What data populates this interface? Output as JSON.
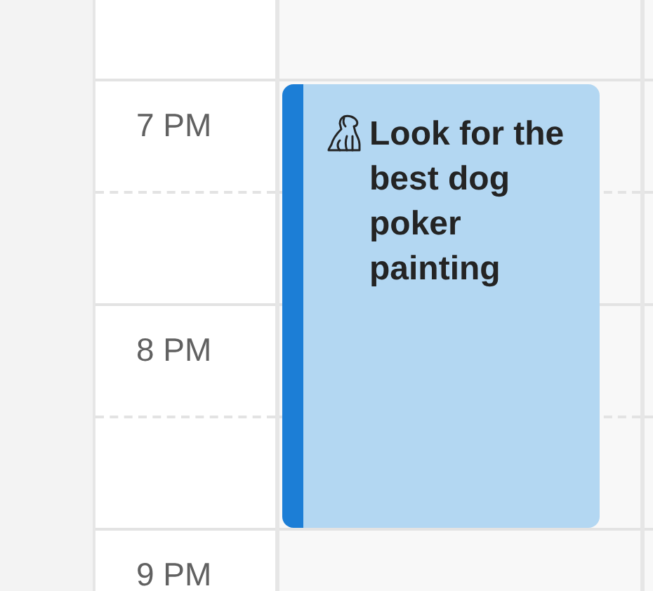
{
  "hours": [
    {
      "label": "7 PM"
    },
    {
      "label": "8 PM"
    },
    {
      "label": "9 PM"
    }
  ],
  "event": {
    "title": "Look for the best dog poker painting"
  }
}
